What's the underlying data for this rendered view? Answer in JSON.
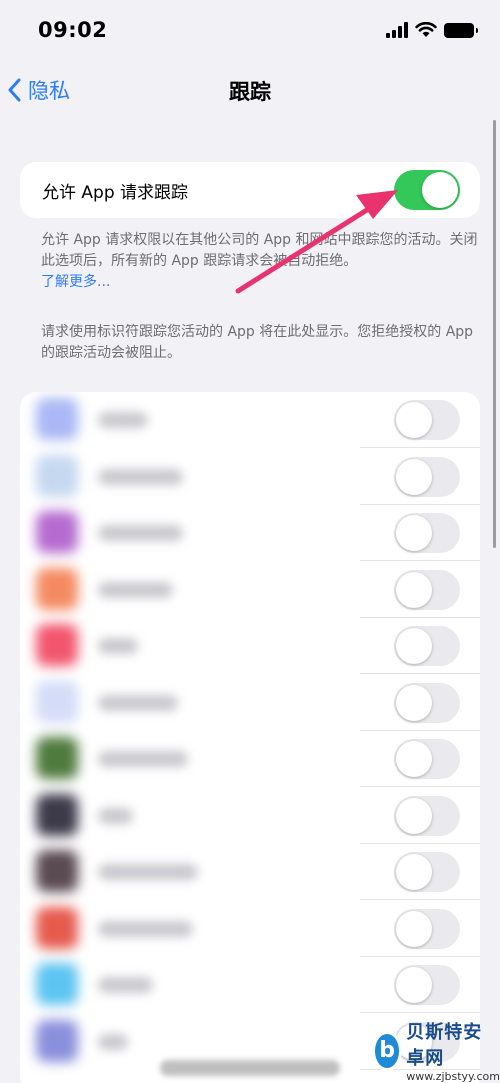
{
  "status_bar": {
    "time": "09:02"
  },
  "nav": {
    "back_label": "隐私",
    "title": "跟踪"
  },
  "tracking_toggle": {
    "label": "允许 App 请求跟踪",
    "state": "on"
  },
  "footnote_1": {
    "text": "允许 App 请求权限以在其他公司的 App 和网站中跟踪您的活动。关闭此选项后，所有新的 App 跟踪请求会被自动拒绝。",
    "link": "了解更多..."
  },
  "footnote_2": {
    "text": "请求使用标识符跟踪您活动的 App 将在此处显示。您拒绝授权的 App 的跟踪活动会被阻止。"
  },
  "app_rows": [
    {
      "icon_color": "#aab8f5",
      "state": "off"
    },
    {
      "icon_color": "#c5d8f0",
      "state": "off"
    },
    {
      "icon_color": "#b56bd0",
      "state": "off"
    },
    {
      "icon_color": "#f58a62",
      "state": "off"
    },
    {
      "icon_color": "#f2566e",
      "state": "off"
    },
    {
      "icon_color": "#d4dcf7",
      "state": "off"
    },
    {
      "icon_color": "#4f7b3e",
      "state": "off"
    },
    {
      "icon_color": "#3d3a4a",
      "state": "off"
    },
    {
      "icon_color": "#5a4a52",
      "state": "off"
    },
    {
      "icon_color": "#e65a4e",
      "state": "off"
    },
    {
      "icon_color": "#5dc4f2",
      "state": "off"
    },
    {
      "icon_color": "#8a8fdc",
      "state": "off"
    }
  ],
  "colors": {
    "accent": "#2f7cf6",
    "toggle_on": "#34c759",
    "annotation_arrow": "#e8336f"
  },
  "watermark": {
    "name": "贝斯特安卓网",
    "url": "www.zjbstyy.com",
    "logo_glyph": "b"
  }
}
